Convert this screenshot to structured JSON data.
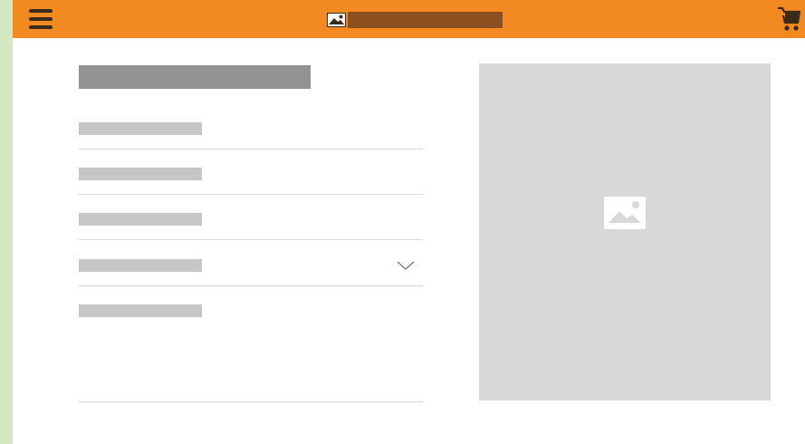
{
  "header": {
    "menu_icon": "hamburger-menu-icon",
    "logo_icon": "image-placeholder-icon",
    "cart_icon": "shopping-cart-icon"
  },
  "form": {
    "fields": [
      {
        "type": "text"
      },
      {
        "type": "text"
      },
      {
        "type": "text"
      },
      {
        "type": "select",
        "indicator": "chevron-down-icon"
      },
      {
        "type": "textarea"
      }
    ]
  },
  "media": {
    "icon": "image-placeholder-icon"
  },
  "colors": {
    "topbar": "#f28a21",
    "left_strip": "#d3e8c2",
    "logo_block": "#8c4f1f",
    "title_placeholder": "#939393",
    "label_placeholder": "#c6c6c6",
    "image_box": "#d8d8d8"
  }
}
